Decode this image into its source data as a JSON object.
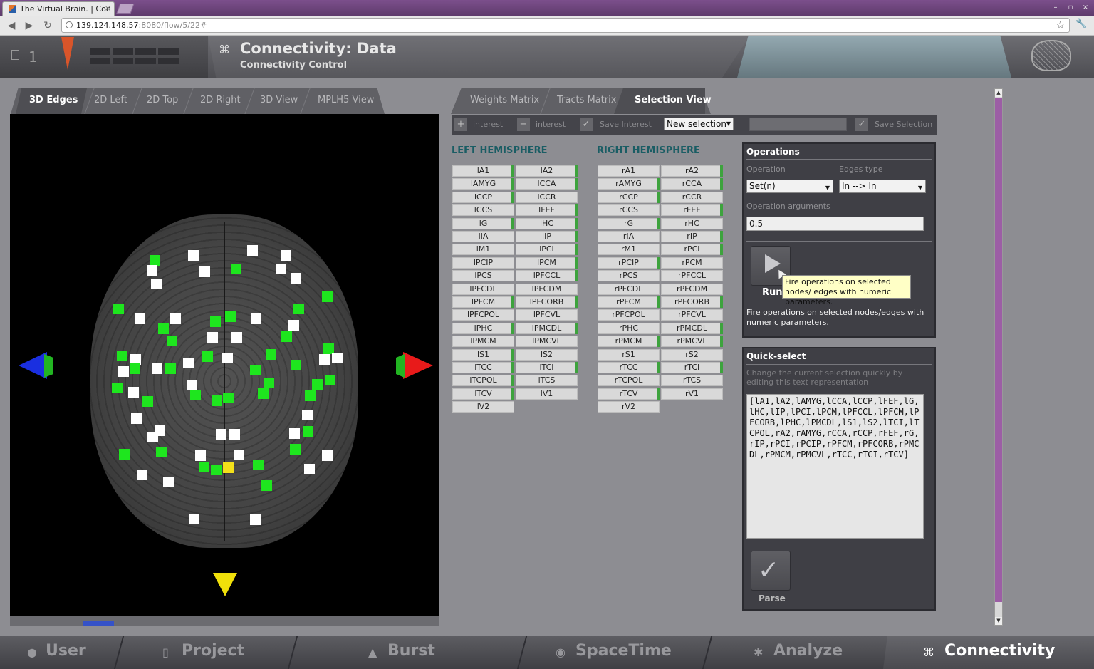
{
  "browser": {
    "tab_title": "The Virtual Brain. | Con",
    "tab_close": "×",
    "url_host": "139.124.148.57",
    "url_rest": ":8080/flow/5/22#",
    "win_min": "–",
    "win_restore": "▫",
    "win_close": "×"
  },
  "header": {
    "project_count": "1",
    "title": "Connectivity: Data",
    "subtitle": "Connectivity Control"
  },
  "left_tabs": [
    "3D Edges",
    "2D Left",
    "2D Top",
    "2D Right",
    "3D View",
    "MPLH5 View"
  ],
  "right_tabs": [
    "Weights Matrix",
    "Tracts Matrix",
    "Selection View"
  ],
  "toolbar": {
    "add_interest": "interest",
    "remove_interest": "interest",
    "save_interest": "Save Interest",
    "selection_dropdown": "New selection",
    "save_selection": "Save Selection"
  },
  "left_hemisphere": {
    "title": "LEFT HEMISPHERE",
    "col1": [
      {
        "label": "lA1",
        "on": true
      },
      {
        "label": "lAMYG",
        "on": true
      },
      {
        "label": "lCCP",
        "on": true
      },
      {
        "label": "lCCS",
        "on": false
      },
      {
        "label": "lG",
        "on": true
      },
      {
        "label": "lIA",
        "on": false
      },
      {
        "label": "lM1",
        "on": false
      },
      {
        "label": "lPCIP",
        "on": false
      },
      {
        "label": "lPCS",
        "on": false
      },
      {
        "label": "lPFCDL",
        "on": false
      },
      {
        "label": "lPFCM",
        "on": true
      },
      {
        "label": "lPFCPOL",
        "on": false
      },
      {
        "label": "lPHC",
        "on": true
      },
      {
        "label": "lPMCM",
        "on": false
      },
      {
        "label": "lS1",
        "on": true
      },
      {
        "label": "lTCC",
        "on": true
      },
      {
        "label": "lTCPOL",
        "on": true
      },
      {
        "label": "lTCV",
        "on": true
      },
      {
        "label": "lV2",
        "on": false
      }
    ],
    "col2": [
      {
        "label": "lA2",
        "on": true
      },
      {
        "label": "lCCA",
        "on": true
      },
      {
        "label": "lCCR",
        "on": false
      },
      {
        "label": "lFEF",
        "on": true
      },
      {
        "label": "lHC",
        "on": true
      },
      {
        "label": "lIP",
        "on": true
      },
      {
        "label": "lPCI",
        "on": true
      },
      {
        "label": "lPCM",
        "on": true
      },
      {
        "label": "lPFCCL",
        "on": true
      },
      {
        "label": "lPFCDM",
        "on": false
      },
      {
        "label": "lPFCORB",
        "on": true
      },
      {
        "label": "lPFCVL",
        "on": false
      },
      {
        "label": "lPMCDL",
        "on": true
      },
      {
        "label": "lPMCVL",
        "on": false
      },
      {
        "label": "lS2",
        "on": false
      },
      {
        "label": "lTCI",
        "on": true
      },
      {
        "label": "lTCS",
        "on": false
      },
      {
        "label": "lV1",
        "on": false
      }
    ]
  },
  "right_hemisphere": {
    "title": "RIGHT HEMISPHERE",
    "col1": [
      {
        "label": "rA1",
        "on": false
      },
      {
        "label": "rAMYG",
        "on": true
      },
      {
        "label": "rCCP",
        "on": true
      },
      {
        "label": "rCCS",
        "on": false
      },
      {
        "label": "rG",
        "on": true
      },
      {
        "label": "rIA",
        "on": false
      },
      {
        "label": "rM1",
        "on": false
      },
      {
        "label": "rPCIP",
        "on": true
      },
      {
        "label": "rPCS",
        "on": false
      },
      {
        "label": "rPFCDL",
        "on": false
      },
      {
        "label": "rPFCM",
        "on": true
      },
      {
        "label": "rPFCPOL",
        "on": false
      },
      {
        "label": "rPHC",
        "on": false
      },
      {
        "label": "rPMCM",
        "on": true
      },
      {
        "label": "rS1",
        "on": false
      },
      {
        "label": "rTCC",
        "on": true
      },
      {
        "label": "rTCPOL",
        "on": false
      },
      {
        "label": "rTCV",
        "on": true
      },
      {
        "label": "rV2",
        "on": false
      }
    ],
    "col2": [
      {
        "label": "rA2",
        "on": true
      },
      {
        "label": "rCCA",
        "on": true
      },
      {
        "label": "rCCR",
        "on": false
      },
      {
        "label": "rFEF",
        "on": true
      },
      {
        "label": "rHC",
        "on": false
      },
      {
        "label": "rIP",
        "on": true
      },
      {
        "label": "rPCI",
        "on": true
      },
      {
        "label": "rPCM",
        "on": false
      },
      {
        "label": "rPFCCL",
        "on": false
      },
      {
        "label": "rPFCDM",
        "on": false
      },
      {
        "label": "rPFCORB",
        "on": true
      },
      {
        "label": "rPFCVL",
        "on": false
      },
      {
        "label": "rPMCDL",
        "on": true
      },
      {
        "label": "rPMCVL",
        "on": true
      },
      {
        "label": "rS2",
        "on": false
      },
      {
        "label": "rTCI",
        "on": true
      },
      {
        "label": "rTCS",
        "on": false
      },
      {
        "label": "rV1",
        "on": false
      }
    ]
  },
  "operations": {
    "title": "Operations",
    "operation_label": "Operation",
    "operation_value": "Set(n)",
    "edges_label": "Edges type",
    "edges_value": "In --> In",
    "args_label": "Operation arguments",
    "args_value": "0.5",
    "run_label": "Run",
    "tooltip": "Fire operations on selected nodes/ edges with numeric parameters.",
    "description": "Fire operations on selected nodes/edges with numeric parameters."
  },
  "quick_select": {
    "title": "Quick-select",
    "hint": "Change the current selection quickly by editing this text representation",
    "text": "[lA1,lA2,lAMYG,lCCA,lCCP,lFEF,lG,lHC,lIP,lPCI,lPCM,lPFCCL,lPFCM,lPFCORB,lPHC,lPMCDL,lS1,lS2,lTCI,lTCPOL,rA2,rAMYG,rCCA,rCCP,rFEF,rG,rIP,rPCI,rPCIP,rPFCM,rPFCORB,rPMCDL,rPMCM,rPMCVL,rTCC,rTCI,rTCV]",
    "parse_label": "Parse"
  },
  "bottom_nav": {
    "user": "User",
    "project": "Project",
    "burst": "Burst",
    "spacetime": "SpaceTime",
    "analyze": "Analyze",
    "connectivity": "Connectivity"
  },
  "colors": {
    "node_selected": "#1ee61e",
    "node_unselected": "#ffffff",
    "node_current": "#f3e01a",
    "hemisphere_title": "#1a5d64",
    "scrollbar": "#9c5ea5"
  }
}
